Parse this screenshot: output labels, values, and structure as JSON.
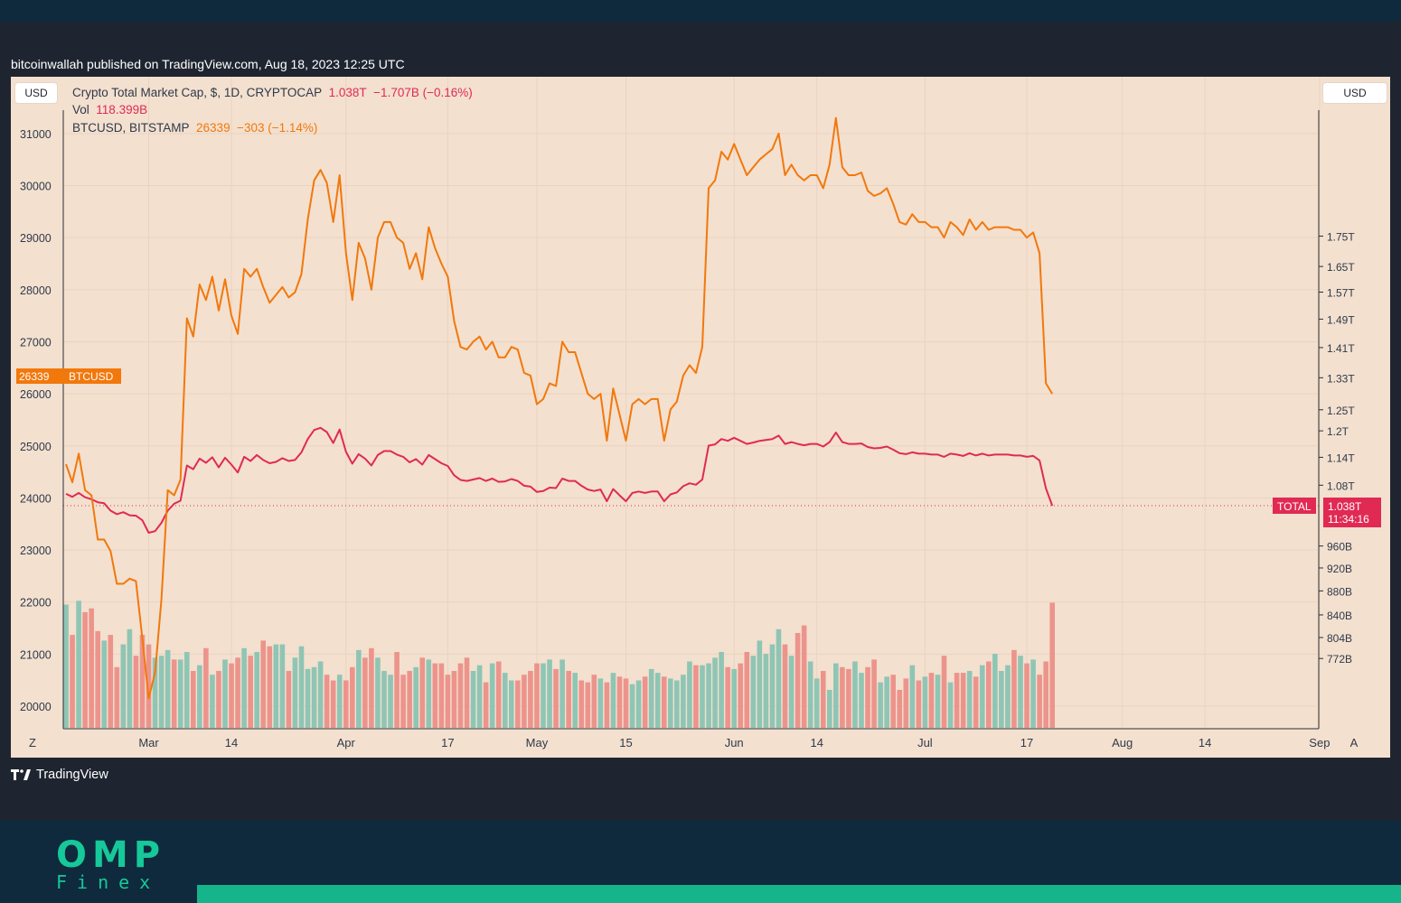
{
  "header": {
    "publisher": "bitcoinwallah published on TradingView.com, Aug 18, 2023 12:25 UTC"
  },
  "legend": {
    "total_name": "Crypto Total Market Cap, $, 1D, CRYPTOCAP",
    "total_value": "1.038T",
    "total_change": "−1.707B (−0.16%)",
    "vol_name": "Vol",
    "vol_value": "118.399B",
    "btc_name": "BTCUSD, BITSTAMP",
    "btc_value": "26339",
    "btc_change": "−303 (−1.14%)"
  },
  "controls": {
    "currency_left": "USD",
    "currency_right": "USD",
    "zoom_button": "Z",
    "auto_button": "A"
  },
  "brand": {
    "tradingview": "TradingView",
    "omp": "OMP",
    "finex": "Finex"
  },
  "colors": {
    "plot_bg": "#f3e0cf",
    "btc_line": "#f2780c",
    "total_line": "#e02a54",
    "volume_up": "#8fc5b4",
    "volume_down": "#ec948c",
    "grid": "#ebd3c0",
    "footer_bg": "#0f2a3d",
    "brand_green": "#16c89a"
  },
  "chart_data": {
    "type": "line",
    "x_start": "2023-02-16",
    "x_ticks": [
      "Mar",
      "14",
      "Apr",
      "17",
      "May",
      "15",
      "Jun",
      "14",
      "Jul",
      "17",
      "Aug",
      "14",
      "Sep"
    ],
    "left_axis": {
      "ticks": [
        20000,
        21000,
        22000,
        23000,
        24000,
        25000,
        26000,
        27000,
        28000,
        29000,
        30000,
        31000
      ],
      "ylim": [
        19570,
        31480
      ],
      "last_value_label": "26339",
      "last_value_series": "BTCUSD"
    },
    "right_axis": {
      "ticks": [
        "1.75T",
        "1.65T",
        "1.57T",
        "1.49T",
        "1.41T",
        "1.33T",
        "1.25T",
        "1.2T",
        "1.14T",
        "1.08T",
        "960B",
        "920B",
        "880B",
        "840B",
        "804B",
        "772B"
      ],
      "last_value_label": "1.038T",
      "last_value_time": "11:34:16",
      "last_value_series": "TOTAL"
    },
    "series": [
      {
        "name": "BTCUSD",
        "values": [
          24650,
          24300,
          24850,
          24150,
          24050,
          23200,
          23200,
          22980,
          22350,
          22350,
          22450,
          22400,
          21300,
          20150,
          20650,
          22050,
          24150,
          24050,
          24350,
          27450,
          27100,
          28100,
          27800,
          28250,
          27600,
          28200,
          27500,
          27150,
          28400,
          28250,
          28400,
          28050,
          27750,
          27900,
          28050,
          27850,
          27950,
          28300,
          29350,
          30100,
          30300,
          30050,
          29300,
          30200,
          28700,
          27800,
          28900,
          28600,
          28000,
          29000,
          29300,
          29300,
          29000,
          28900,
          28400,
          28700,
          28200,
          29200,
          28800,
          28500,
          28250,
          27400,
          26900,
          26850,
          27000,
          27100,
          26850,
          27000,
          26700,
          26700,
          26900,
          26850,
          26400,
          26350,
          25800,
          25900,
          26200,
          26150,
          27000,
          26800,
          26800,
          26400,
          26000,
          25900,
          26000,
          25100,
          26100,
          25600,
          25100,
          25800,
          25900,
          25800,
          25900,
          25900,
          25100,
          25700,
          25850,
          26350,
          26550,
          26400,
          26900,
          29950,
          30100,
          30650,
          30500,
          30800,
          30500,
          30200,
          30350,
          30500,
          30600,
          30700,
          31000,
          30200,
          30400,
          30200,
          30100,
          30200,
          30200,
          29950,
          30400,
          31300,
          30350,
          30200,
          30200,
          30250,
          29900,
          29800,
          29850,
          29950,
          29650,
          29300,
          29250,
          29450,
          29300,
          29300,
          29200,
          29200,
          29000,
          29300,
          29200,
          29050,
          29350,
          29150,
          29300,
          29150,
          29200,
          29200,
          29200,
          29150,
          29150,
          29000,
          29100,
          28700,
          26200,
          26000
        ]
      },
      {
        "name": "TOTAL",
        "values": [
          1.062,
          1.056,
          1.064,
          1.055,
          1.051,
          1.045,
          1.043,
          1.028,
          1.021,
          1.025,
          1.019,
          1.018,
          1.009,
          0.985,
          0.988,
          1.004,
          1.028,
          1.042,
          1.048,
          1.122,
          1.114,
          1.137,
          1.128,
          1.14,
          1.118,
          1.139,
          1.124,
          1.107,
          1.141,
          1.132,
          1.145,
          1.134,
          1.127,
          1.13,
          1.138,
          1.132,
          1.134,
          1.151,
          1.181,
          1.202,
          1.207,
          1.197,
          1.172,
          1.203,
          1.152,
          1.126,
          1.147,
          1.137,
          1.122,
          1.145,
          1.154,
          1.154,
          1.146,
          1.141,
          1.129,
          1.136,
          1.124,
          1.145,
          1.136,
          1.127,
          1.121,
          1.101,
          1.091,
          1.089,
          1.092,
          1.095,
          1.089,
          1.094,
          1.087,
          1.088,
          1.093,
          1.089,
          1.079,
          1.077,
          1.066,
          1.068,
          1.075,
          1.074,
          1.094,
          1.089,
          1.089,
          1.079,
          1.071,
          1.068,
          1.071,
          1.047,
          1.072,
          1.059,
          1.047,
          1.064,
          1.067,
          1.064,
          1.067,
          1.067,
          1.047,
          1.061,
          1.065,
          1.078,
          1.084,
          1.081,
          1.092,
          1.166,
          1.169,
          1.181,
          1.177,
          1.184,
          1.177,
          1.17,
          1.173,
          1.177,
          1.179,
          1.181,
          1.189,
          1.17,
          1.174,
          1.17,
          1.167,
          1.17,
          1.17,
          1.164,
          1.174,
          1.196,
          1.174,
          1.17,
          1.17,
          1.171,
          1.163,
          1.16,
          1.161,
          1.164,
          1.157,
          1.149,
          1.147,
          1.151,
          1.148,
          1.148,
          1.146,
          1.146,
          1.141,
          1.148,
          1.146,
          1.143,
          1.149,
          1.144,
          1.148,
          1.144,
          1.146,
          1.146,
          1.146,
          1.144,
          1.144,
          1.141,
          1.143,
          1.133,
          1.073,
          1.038
        ]
      }
    ],
    "volume": {
      "name": "Vol",
      "values": [
        65,
        49,
        67,
        61,
        63,
        51,
        46,
        49,
        32,
        44,
        52,
        38,
        49,
        44,
        37,
        38,
        41,
        36,
        36,
        40,
        30,
        33,
        42,
        28,
        30,
        36,
        34,
        37,
        42,
        38,
        40,
        46,
        43,
        44,
        44,
        30,
        37,
        43,
        31,
        32,
        35,
        28,
        25,
        28,
        25,
        32,
        41,
        37,
        42,
        37,
        30,
        28,
        40,
        28,
        30,
        32,
        37,
        36,
        34,
        34,
        28,
        30,
        34,
        37,
        30,
        33,
        24,
        34,
        35,
        29,
        25,
        25,
        28,
        30,
        34,
        34,
        36,
        31,
        36,
        30,
        29,
        25,
        24,
        28,
        26,
        24,
        29,
        27,
        26,
        23,
        25,
        27,
        31,
        29,
        27,
        26,
        25,
        28,
        35,
        33,
        33,
        34,
        37,
        40,
        32,
        31,
        34,
        40,
        38,
        46,
        39,
        44,
        52,
        44,
        38,
        50,
        54,
        35,
        26,
        30,
        20,
        34,
        32,
        31,
        35,
        29,
        32,
        36,
        24,
        27,
        28,
        20,
        26,
        33,
        25,
        27,
        29,
        28,
        38,
        24,
        29,
        29,
        30,
        27,
        33,
        35,
        39,
        30,
        33,
        41,
        38,
        34,
        36,
        28,
        35,
        66
      ]
    }
  }
}
